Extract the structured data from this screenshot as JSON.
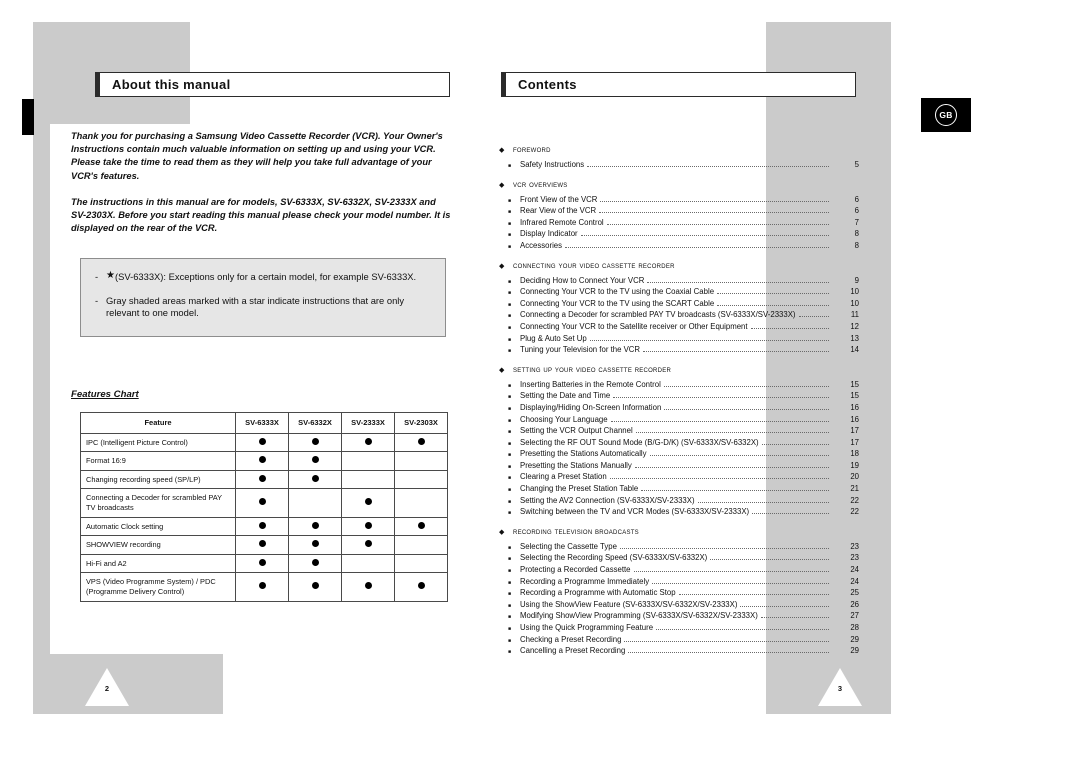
{
  "document": {
    "language_badge": "GB",
    "left_page": {
      "number": "2",
      "title": "About this manual",
      "intro_paragraphs": [
        "Thank you for purchasing a Samsung Video Cassette Recorder (VCR). Your Owner's Instructions contain much valuable information on setting up and using your VCR. Please take the time to read them as they will help you take full advantage of your VCR's features.",
        "The instructions in this manual are for models, SV-6333X, SV-6332X, SV-2333X and SV-2303X. Before you start reading this manual please check your model number. It is displayed on the rear of the VCR."
      ],
      "note_box": {
        "line1_dash": "-",
        "line1_star": "★",
        "line1_text": "(SV-6333X): Exceptions only for a certain model, for example SV-6333X.",
        "line2_dash": "-",
        "line2_text": "Gray shaded areas marked with a star indicate instructions that are only relevant to one model."
      },
      "features_chart": {
        "heading": "Features Chart",
        "columns": [
          "Feature",
          "SV-6333X",
          "SV-6332X",
          "SV-2333X",
          "SV-2303X"
        ],
        "rows": [
          {
            "feature": "IPC (Intelligent Picture Control)",
            "marks": [
              true,
              true,
              true,
              true
            ]
          },
          {
            "feature": "Format 16:9",
            "marks": [
              true,
              true,
              false,
              false
            ]
          },
          {
            "feature": "Changing recording speed (SP/LP)",
            "marks": [
              true,
              true,
              false,
              false
            ]
          },
          {
            "feature": "Connecting a Decoder for scrambled PAY TV broadcasts",
            "marks": [
              true,
              false,
              true,
              false
            ]
          },
          {
            "feature": "Automatic Clock setting",
            "marks": [
              true,
              true,
              true,
              true
            ]
          },
          {
            "feature": "SHOWVIEW recording",
            "marks": [
              true,
              true,
              true,
              false
            ]
          },
          {
            "feature": "Hi-Fi and A2",
            "marks": [
              true,
              true,
              false,
              false
            ]
          },
          {
            "feature": "VPS (Video Programme System) / PDC (Programme Delivery Control)",
            "marks": [
              true,
              true,
              true,
              true
            ]
          }
        ]
      }
    },
    "right_page": {
      "number": "3",
      "title": "Contents",
      "sections": [
        {
          "name": "Foreword",
          "items": [
            {
              "label": "Safety Instructions",
              "page": "5"
            }
          ]
        },
        {
          "name": "VCR Overviews",
          "items": [
            {
              "label": "Front View of the VCR",
              "page": "6"
            },
            {
              "label": "Rear View of the VCR",
              "page": "6"
            },
            {
              "label": "Infrared Remote Control",
              "page": "7"
            },
            {
              "label": "Display Indicator",
              "page": "8"
            },
            {
              "label": "Accessories",
              "page": "8"
            }
          ]
        },
        {
          "name": "Connecting Your Video Cassette Recorder",
          "items": [
            {
              "label": "Deciding How to Connect Your VCR",
              "page": "9"
            },
            {
              "label": "Connecting Your VCR to the TV using the Coaxial Cable",
              "page": "10"
            },
            {
              "label": "Connecting Your VCR to the TV using the SCART Cable",
              "page": "10"
            },
            {
              "label": "Connecting a Decoder for scrambled PAY TV broadcasts (SV-6333X/SV-2333X)",
              "page": "11"
            },
            {
              "label": "Connecting Your VCR to the Satellite receiver or Other Equipment",
              "page": "12"
            },
            {
              "label": "Plug & Auto Set Up",
              "page": "13"
            },
            {
              "label": "Tuning your Television for the VCR",
              "page": "14"
            }
          ]
        },
        {
          "name": "Setting Up Your Video Cassette Recorder",
          "items": [
            {
              "label": "Inserting Batteries in the Remote Control",
              "page": "15"
            },
            {
              "label": "Setting the Date and Time",
              "page": "15"
            },
            {
              "label": "Displaying/Hiding On-Screen Information",
              "page": "16"
            },
            {
              "label": "Choosing Your Language",
              "page": "16"
            },
            {
              "label": "Setting the VCR Output Channel",
              "page": "17"
            },
            {
              "label": "Selecting the RF OUT Sound Mode (B/G-D/K) (SV-6333X/SV-6332X)",
              "page": "17"
            },
            {
              "label": "Presetting the Stations Automatically",
              "page": "18"
            },
            {
              "label": "Presetting the Stations Manually",
              "page": "19"
            },
            {
              "label": "Clearing a Preset Station",
              "page": "20"
            },
            {
              "label": "Changing the Preset Station Table",
              "page": "21"
            },
            {
              "label": "Setting the AV2 Connection (SV-6333X/SV-2333X)",
              "page": "22"
            },
            {
              "label": "Switching between the TV and VCR Modes (SV-6333X/SV-2333X)",
              "page": "22"
            }
          ]
        },
        {
          "name": "Recording Television Broadcasts",
          "items": [
            {
              "label": "Selecting the Cassette Type",
              "page": "23"
            },
            {
              "label": "Selecting the Recording Speed (SV-6333X/SV-6332X)",
              "page": "23"
            },
            {
              "label": "Protecting a Recorded Cassette",
              "page": "24"
            },
            {
              "label": "Recording a Programme Immediately",
              "page": "24"
            },
            {
              "label": "Recording a Programme with Automatic Stop",
              "page": "25"
            },
            {
              "label": "Using the ShowView Feature (SV-6333X/SV-6332X/SV-2333X)",
              "page": "26"
            },
            {
              "label": "Modifying ShowView Programming (SV-6333X/SV-6332X/SV-2333X)",
              "page": "27"
            },
            {
              "label": "Using the Quick Programming Feature",
              "page": "28"
            },
            {
              "label": "Checking a Preset Recording",
              "page": "29"
            },
            {
              "label": "Cancelling a Preset Recording",
              "page": "29"
            }
          ]
        }
      ],
      "section_marker": "◆",
      "item_marker": "■"
    }
  }
}
